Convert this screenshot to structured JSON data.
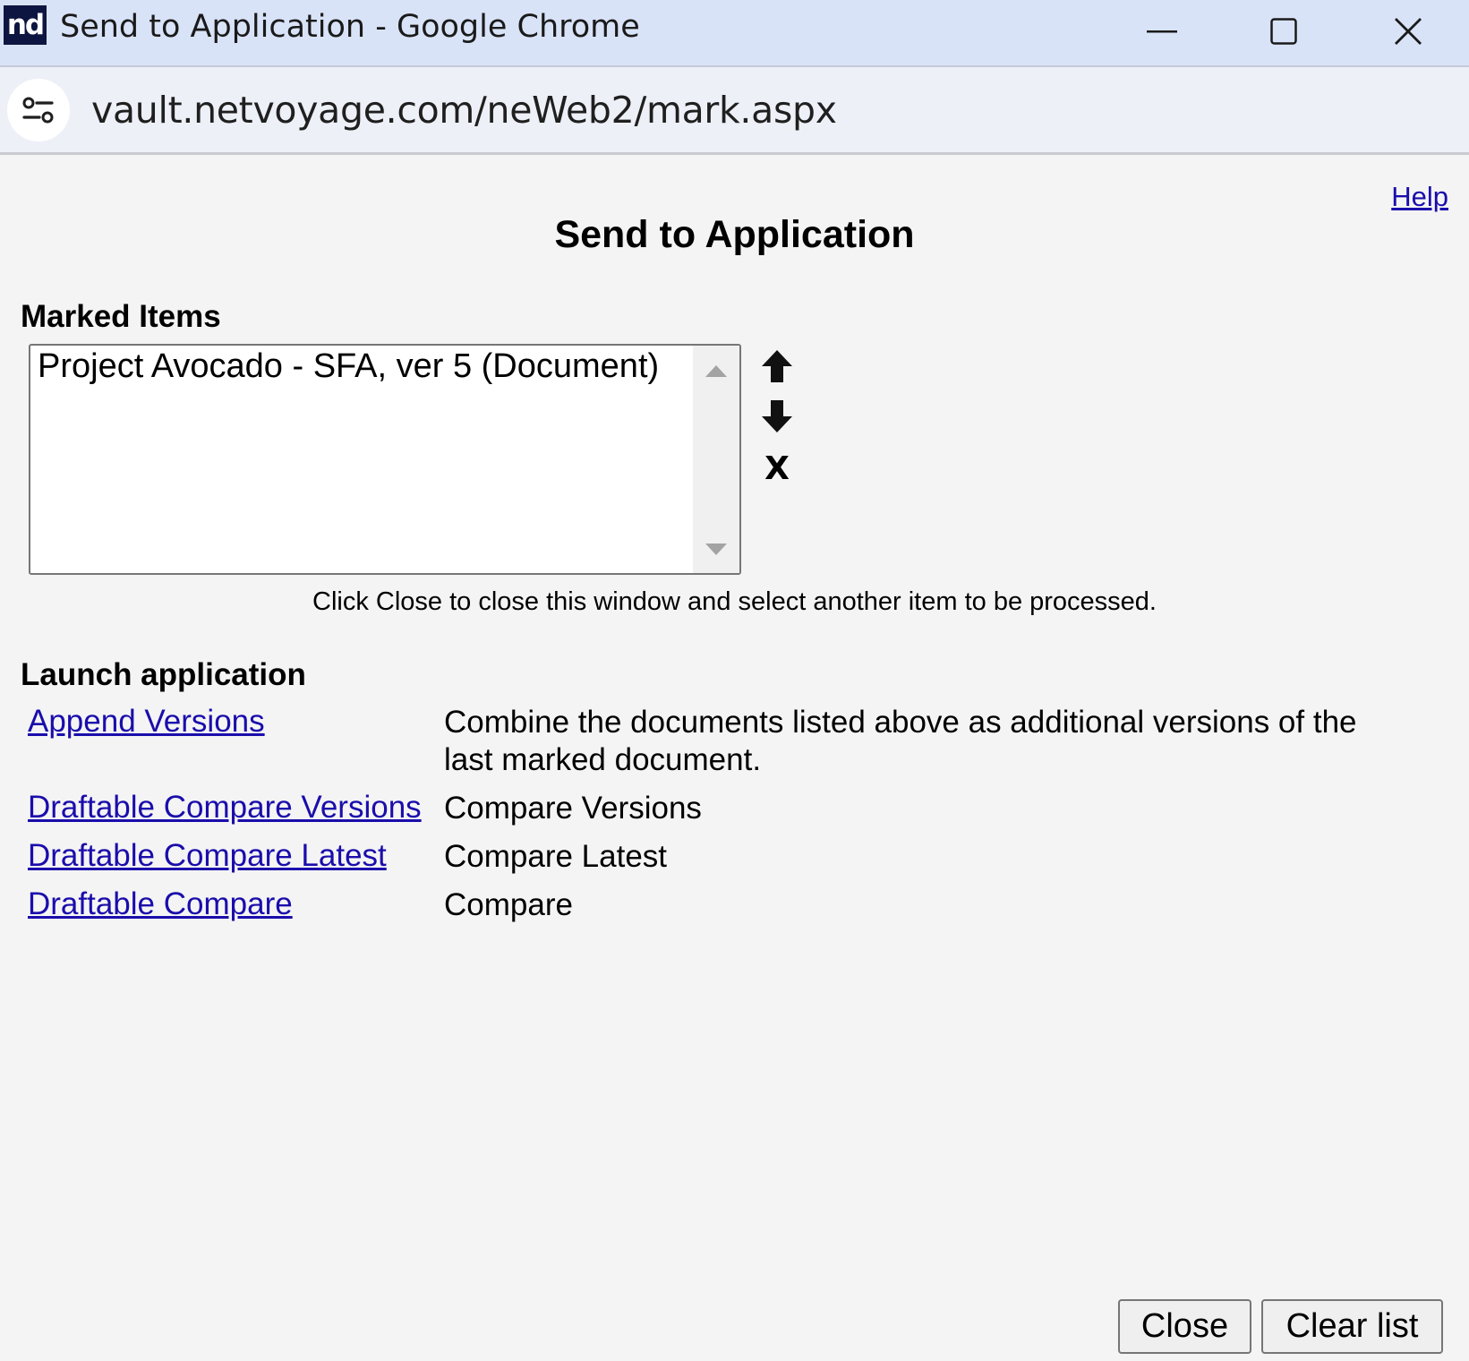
{
  "window": {
    "logo_text": "nd",
    "title": "Send to Application - Google Chrome"
  },
  "address_bar": {
    "url": "vault.netvoyage.com/neWeb2/mark.aspx"
  },
  "page": {
    "help_label": "Help",
    "title": "Send to Application",
    "marked_items_heading": "Marked Items",
    "marked_items": [
      "Project Avocado - SFA, ver 5 (Document)"
    ],
    "list_tools": {
      "remove_label": "X"
    },
    "hint": "Click Close to close this window and select another item to be processed.",
    "launch_heading": "Launch application",
    "applications": [
      {
        "link": "Append Versions",
        "description": "Combine the documents listed above as additional versions of the last marked document."
      },
      {
        "link": "Draftable Compare Versions",
        "description": "Compare Versions"
      },
      {
        "link": "Draftable Compare Latest",
        "description": "Compare Latest"
      },
      {
        "link": "Draftable Compare",
        "description": "Compare"
      }
    ],
    "buttons": {
      "close": "Close",
      "clear_list": "Clear list"
    }
  },
  "colors": {
    "titlebar": "#d9e3f8",
    "addressbar": "#edf0f7",
    "link": "#1a0dab",
    "page_bg": "#f4f4f4"
  }
}
